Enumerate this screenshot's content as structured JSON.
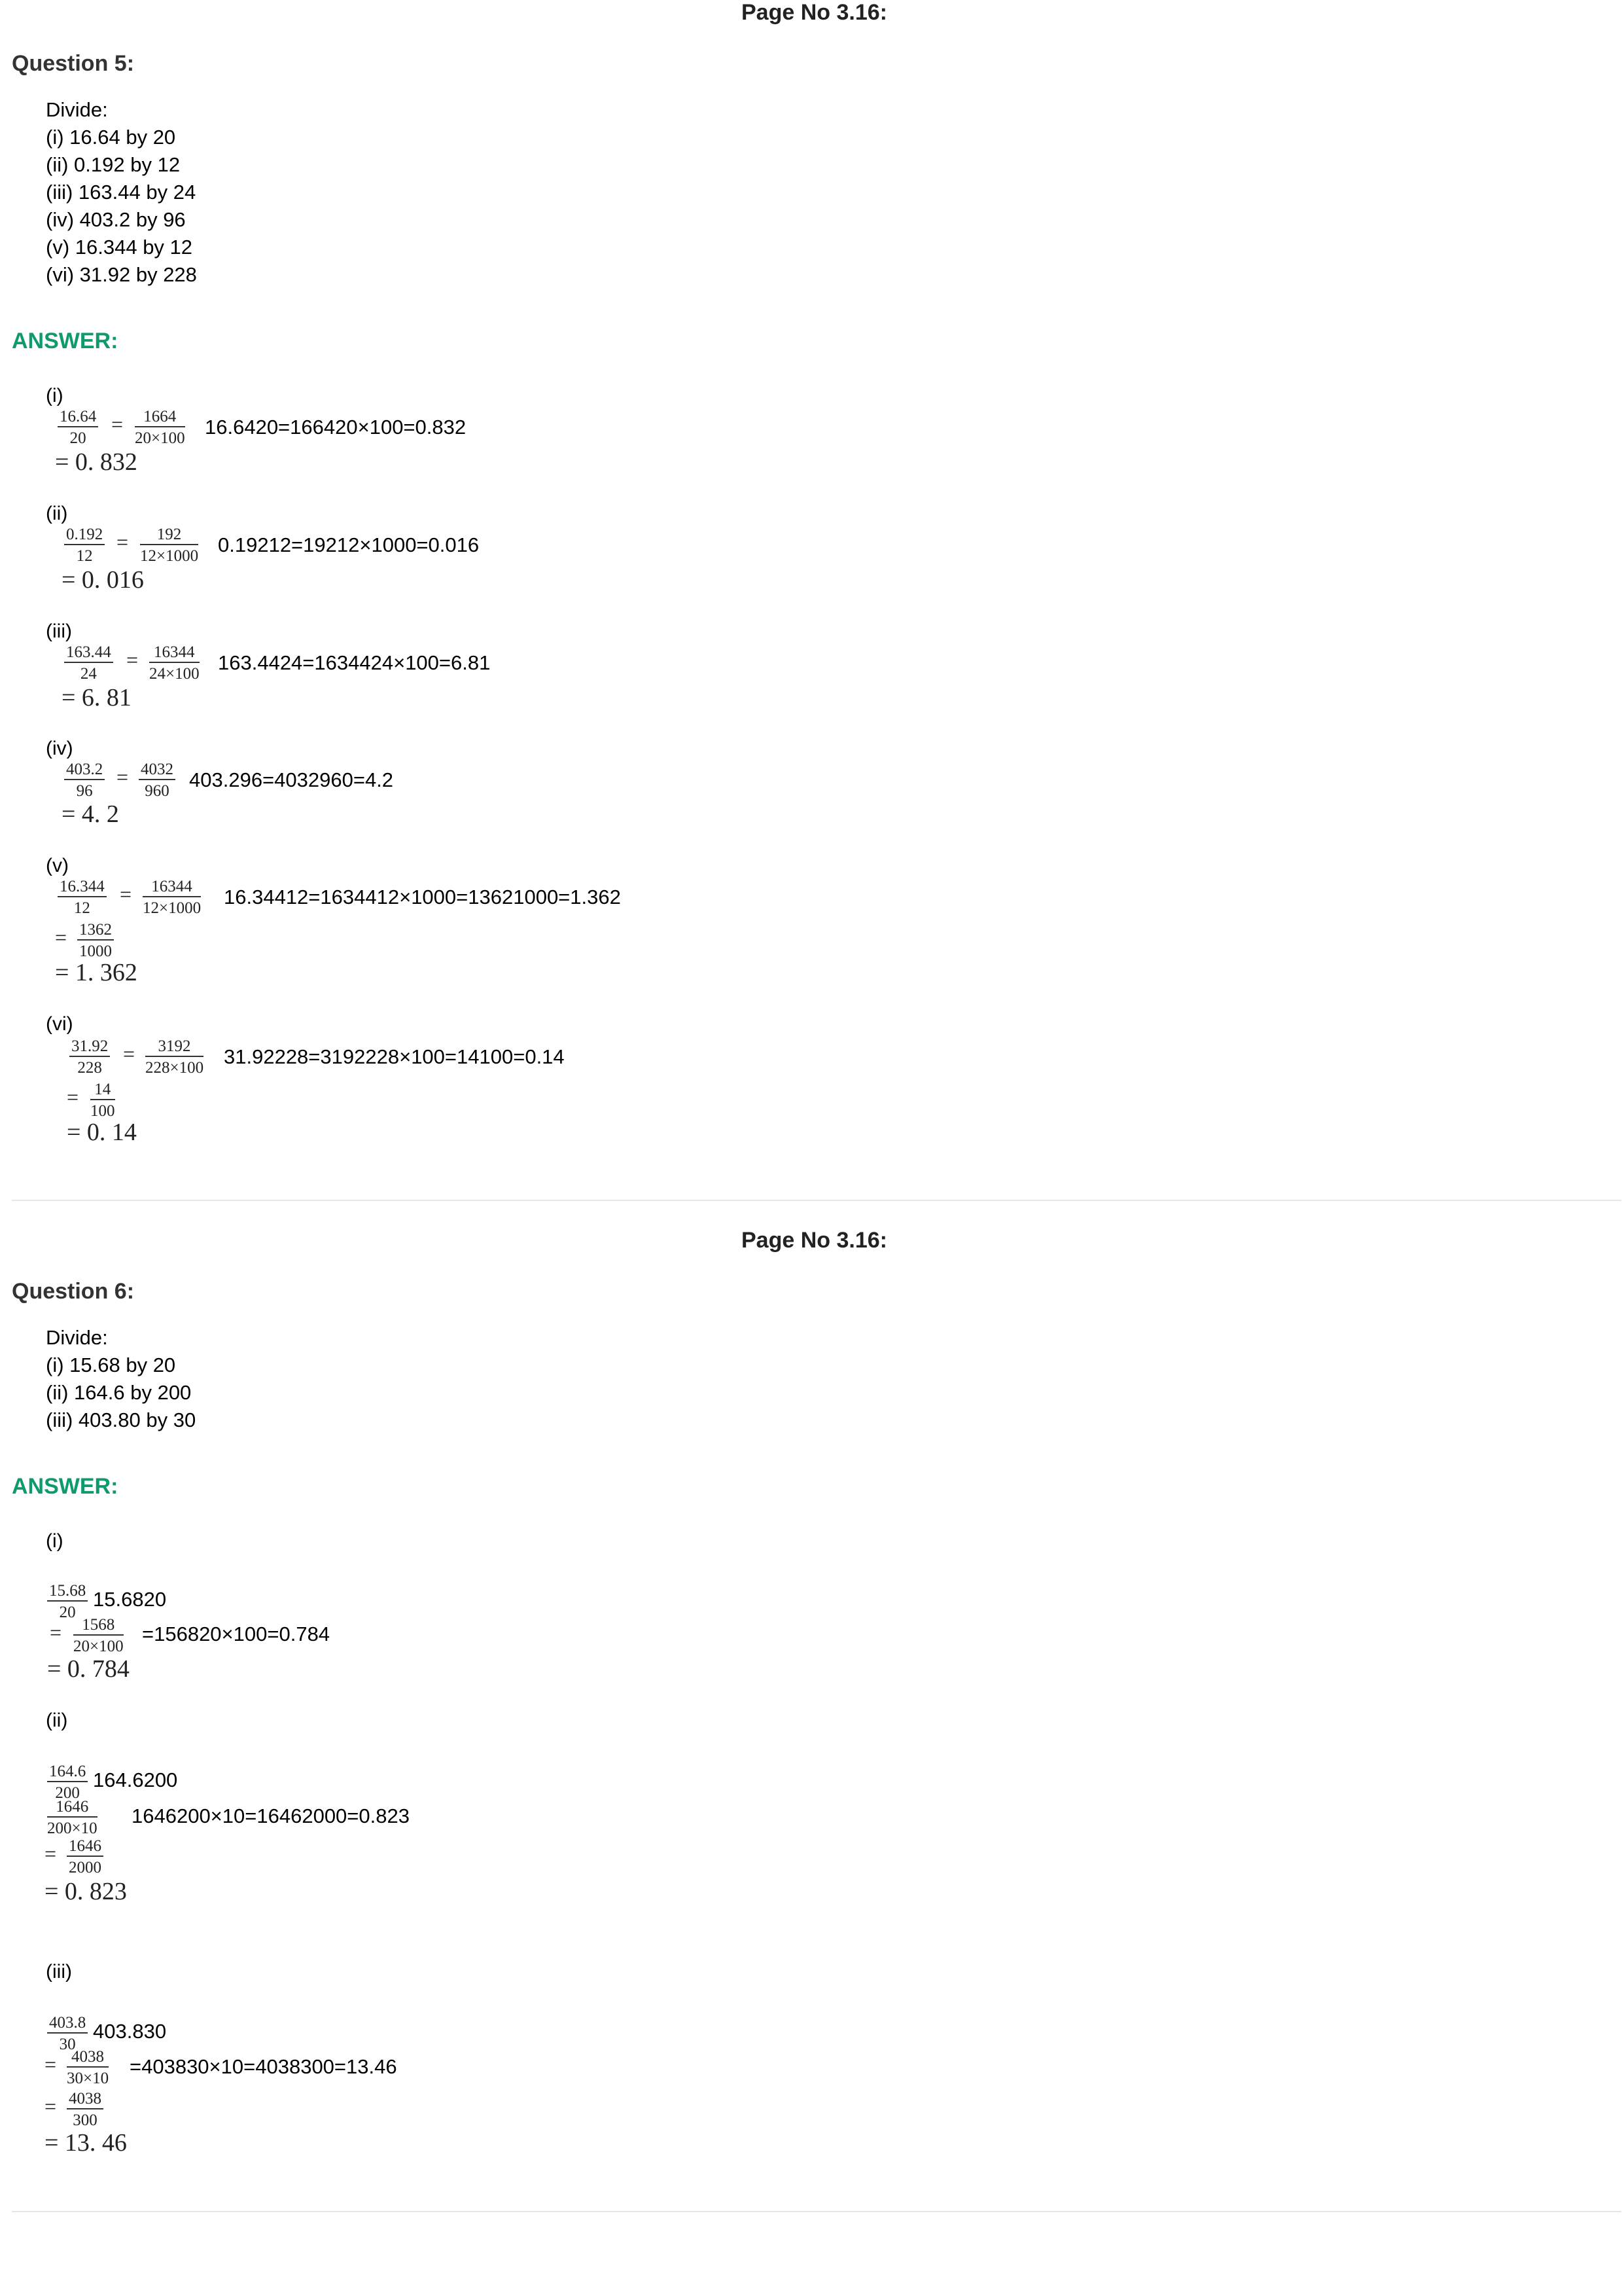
{
  "q5": {
    "page_no": "Page No 3.16:",
    "title": "Question 5:",
    "lines": [
      "Divide:",
      "(i) 16.64 by 20",
      "(ii) 0.192 by 12",
      "(iii) 163.44 by 24",
      "(iv) 403.2 by 96",
      "(v) 16.344 by 12",
      "(vi) 31.92 by 228"
    ],
    "answer_label": "ANSWER:",
    "parts": [
      {
        "label": "(i)",
        "f1n": "16.64",
        "f1d": "20",
        "f2n": "1664",
        "f2d": "20×100",
        "alt": "16.6420=166420×100=0.832",
        "result": "= 0. 832"
      },
      {
        "label": "(ii)",
        "f1n": "0.192",
        "f1d": "12",
        "f2n": "192",
        "f2d": "12×1000",
        "alt": "0.19212=19212×1000=0.016",
        "result": "= 0. 016"
      },
      {
        "label": "(iii)",
        "f1n": "163.44",
        "f1d": "24",
        "f2n": "16344",
        "f2d": "24×100",
        "alt": "163.4424=1634424×100=6.81",
        "result": "= 6. 81"
      },
      {
        "label": "(iv)",
        "f1n": "403.2",
        "f1d": "96",
        "f2n": "4032",
        "f2d": "960",
        "alt": "403.296=4032960=4.2",
        "result": "= 4. 2"
      },
      {
        "label": "(v)",
        "f1n": "16.344",
        "f1d": "12",
        "f2n": "16344",
        "f2d": "12×1000",
        "alt": "16.34412=1634412×1000=13621000=1.362",
        "f3n": "1362",
        "f3d": "1000",
        "result": "= 1. 362"
      },
      {
        "label": "(vi)",
        "f1n": "31.92",
        "f1d": "228",
        "f2n": "3192",
        "f2d": "228×100",
        "alt": "31.92228=3192228×100=14100=0.14",
        "f3n": "14",
        "f3d": "100",
        "result": "= 0. 14"
      }
    ]
  },
  "q6": {
    "page_no": "Page No 3.16:",
    "title": "Question 6:",
    "lines": [
      "Divide:",
      "(i) 15.68 by 20",
      "(ii) 164.6 by 200",
      "(iii) 403.80 by 30"
    ],
    "answer_label": "ANSWER:",
    "parts": [
      {
        "label": "(i)",
        "f1n": "15.68",
        "f1d": "20",
        "alt1": "15.6820",
        "f2n": "1568",
        "f2d": "20×100",
        "alt2": "=156820×100=0.784",
        "result": "= 0. 784"
      },
      {
        "label": "(ii)",
        "f1n": "164.6",
        "f1d": "200",
        "alt1": "164.6200",
        "f2n": "1646",
        "f2d": "200×10",
        "alt2": "1646200×10=16462000=0.823",
        "f3n": "1646",
        "f3d": "2000",
        "result": "= 0. 823"
      },
      {
        "label": "(iii)",
        "f1n": "403.8",
        "f1d": "30",
        "alt1": "403.830",
        "f2n": "4038",
        "f2d": "30×10",
        "alt2": "=403830×10=4038300=13.46",
        "f3n": "4038",
        "f3d": "300",
        "result": "= 13. 46"
      }
    ]
  }
}
